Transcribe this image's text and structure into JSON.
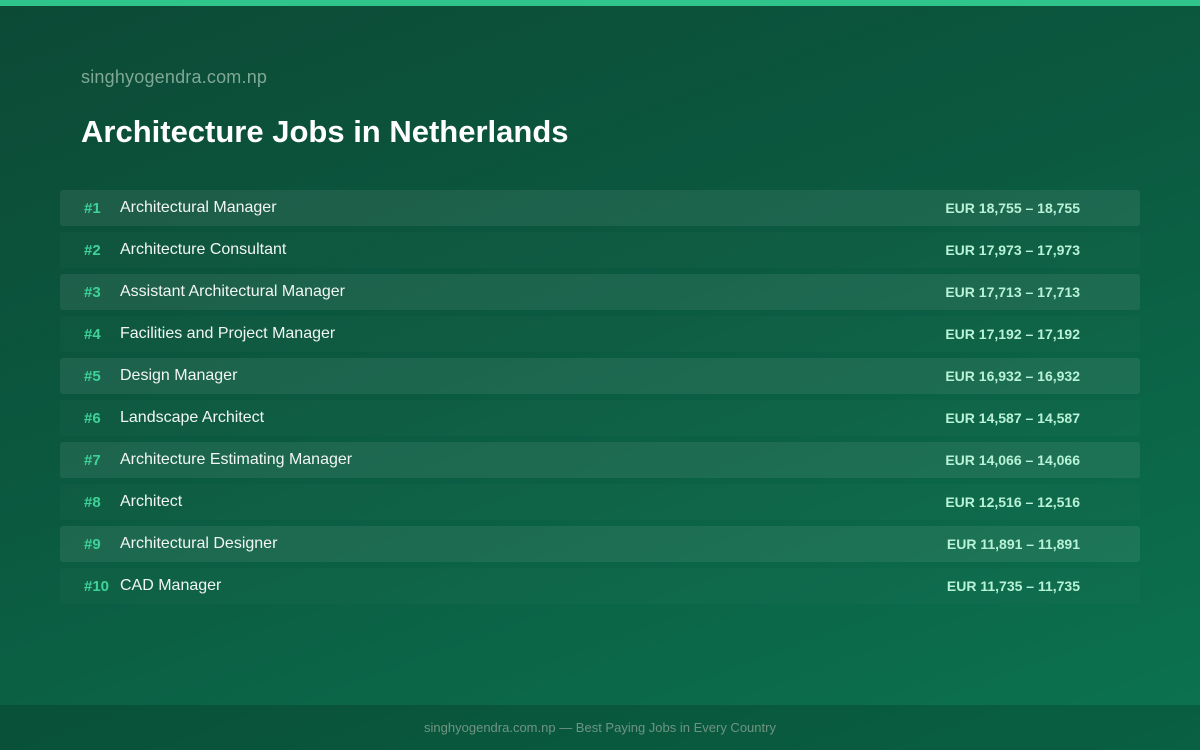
{
  "header": {
    "site": "singhyogendra.com.np",
    "title": "Architecture Jobs in Netherlands"
  },
  "jobs": [
    {
      "rank": "#1",
      "title": "Architectural Manager",
      "salary": "EUR 18,755 – 18,755"
    },
    {
      "rank": "#2",
      "title": "Architecture Consultant",
      "salary": "EUR 17,973 – 17,973"
    },
    {
      "rank": "#3",
      "title": "Assistant Architectural Manager",
      "salary": "EUR 17,713 – 17,713"
    },
    {
      "rank": "#4",
      "title": "Facilities and Project Manager",
      "salary": "EUR 17,192 – 17,192"
    },
    {
      "rank": "#5",
      "title": "Design Manager",
      "salary": "EUR 16,932 – 16,932"
    },
    {
      "rank": "#6",
      "title": "Landscape Architect",
      "salary": "EUR 14,587 – 14,587"
    },
    {
      "rank": "#7",
      "title": "Architecture Estimating Manager",
      "salary": "EUR 14,066 – 14,066"
    },
    {
      "rank": "#8",
      "title": "Architect",
      "salary": "EUR 12,516 – 12,516"
    },
    {
      "rank": "#9",
      "title": "Architectural Designer",
      "salary": "EUR 11,891 – 11,891"
    },
    {
      "rank": "#10",
      "title": "CAD Manager",
      "salary": "EUR 11,735 – 11,735"
    }
  ],
  "footer": {
    "text": "singhyogendra.com.np — Best Paying Jobs in Every Country"
  },
  "colors": {
    "accent": "#2fc48a",
    "rank": "#3ed29a",
    "salary": "#b8f2d8",
    "background": "#0b5a40"
  }
}
